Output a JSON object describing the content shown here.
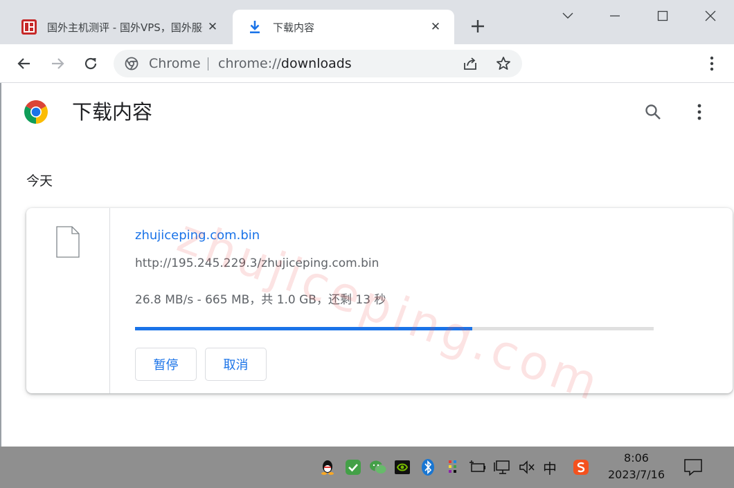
{
  "tabs": [
    {
      "title": "国外主机测评 - 国外VPS，国外服务器，国外主机",
      "close": "✕"
    },
    {
      "title": "下载内容",
      "close": "✕"
    }
  ],
  "toolbar": {
    "omnibox_chip": "Chrome",
    "url_scheme": "chrome://",
    "url_host": "downloads"
  },
  "page": {
    "title": "下载内容",
    "date_heading": "今天"
  },
  "download": {
    "file_name": "zhujiceping.com.bin",
    "url": "http://195.245.229.3/zhujiceping.com.bin",
    "status": "26.8 MB/s - 665 MB，共 1.0 GB，还剩 13 秒",
    "progress": 0.65,
    "pause_label": "暂停",
    "cancel_label": "取消"
  },
  "watermark": "zhujiceping.com",
  "taskbar": {
    "ime": "中",
    "time": "8:06",
    "date": "2023/7/16"
  },
  "colors": {
    "accent": "#1a73e8",
    "tabstrip": "#dee1e6",
    "taskbar": "#8f8f8f"
  }
}
